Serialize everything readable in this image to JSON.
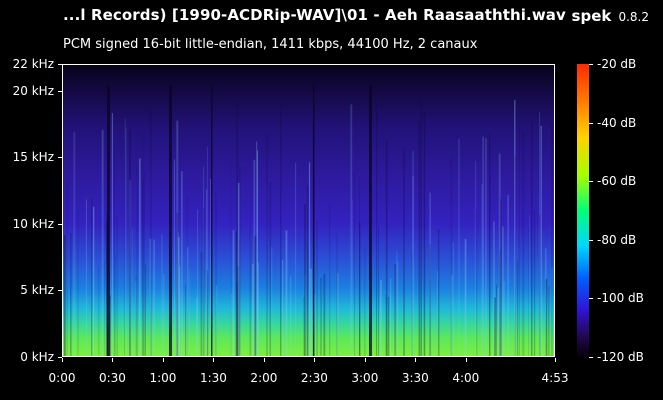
{
  "header": {
    "title": "...l Records) [1990-ACDRip-WAV]\\01 - Aeh Raasaaththi.wav",
    "app_name": "spek",
    "app_version": "0.8.2",
    "subtitle": "PCM signed 16-bit little-endian, 1411 kbps, 44100 Hz, 2 canaux"
  },
  "axes": {
    "y_ticks": [
      {
        "label": "22 kHz",
        "value": 22
      },
      {
        "label": "20 kHz",
        "value": 20
      },
      {
        "label": "15 kHz",
        "value": 15
      },
      {
        "label": "10 kHz",
        "value": 10
      },
      {
        "label": "5 kHz",
        "value": 5
      },
      {
        "label": "0 kHz",
        "value": 0
      }
    ],
    "x_ticks": [
      {
        "label": "0:00",
        "seconds": 0
      },
      {
        "label": "0:30",
        "seconds": 30
      },
      {
        "label": "1:00",
        "seconds": 60
      },
      {
        "label": "1:30",
        "seconds": 90
      },
      {
        "label": "2:00",
        "seconds": 120
      },
      {
        "label": "2:30",
        "seconds": 150
      },
      {
        "label": "3:00",
        "seconds": 180
      },
      {
        "label": "3:30",
        "seconds": 210
      },
      {
        "label": "4:00",
        "seconds": 240
      },
      {
        "label": "4:53",
        "seconds": 293
      }
    ],
    "y_max_khz": 22,
    "duration_seconds": 293
  },
  "colorbar": {
    "ticks": [
      {
        "label": "-20 dB",
        "value": -20
      },
      {
        "label": "-40 dB",
        "value": -40
      },
      {
        "label": "-60 dB",
        "value": -60
      },
      {
        "label": "-80 dB",
        "value": -80
      },
      {
        "label": "-100 dB",
        "value": -100
      },
      {
        "label": "-120 dB",
        "value": -120
      }
    ],
    "min_db": -120,
    "max_db": -20
  },
  "colors": {
    "background": "#000000",
    "text": "#ffffff",
    "low_freq_band": "#60e84a",
    "mid_band": "#1c9bd9",
    "high_band": "#3a1fb5",
    "top_band": "#1a0a4a"
  }
}
